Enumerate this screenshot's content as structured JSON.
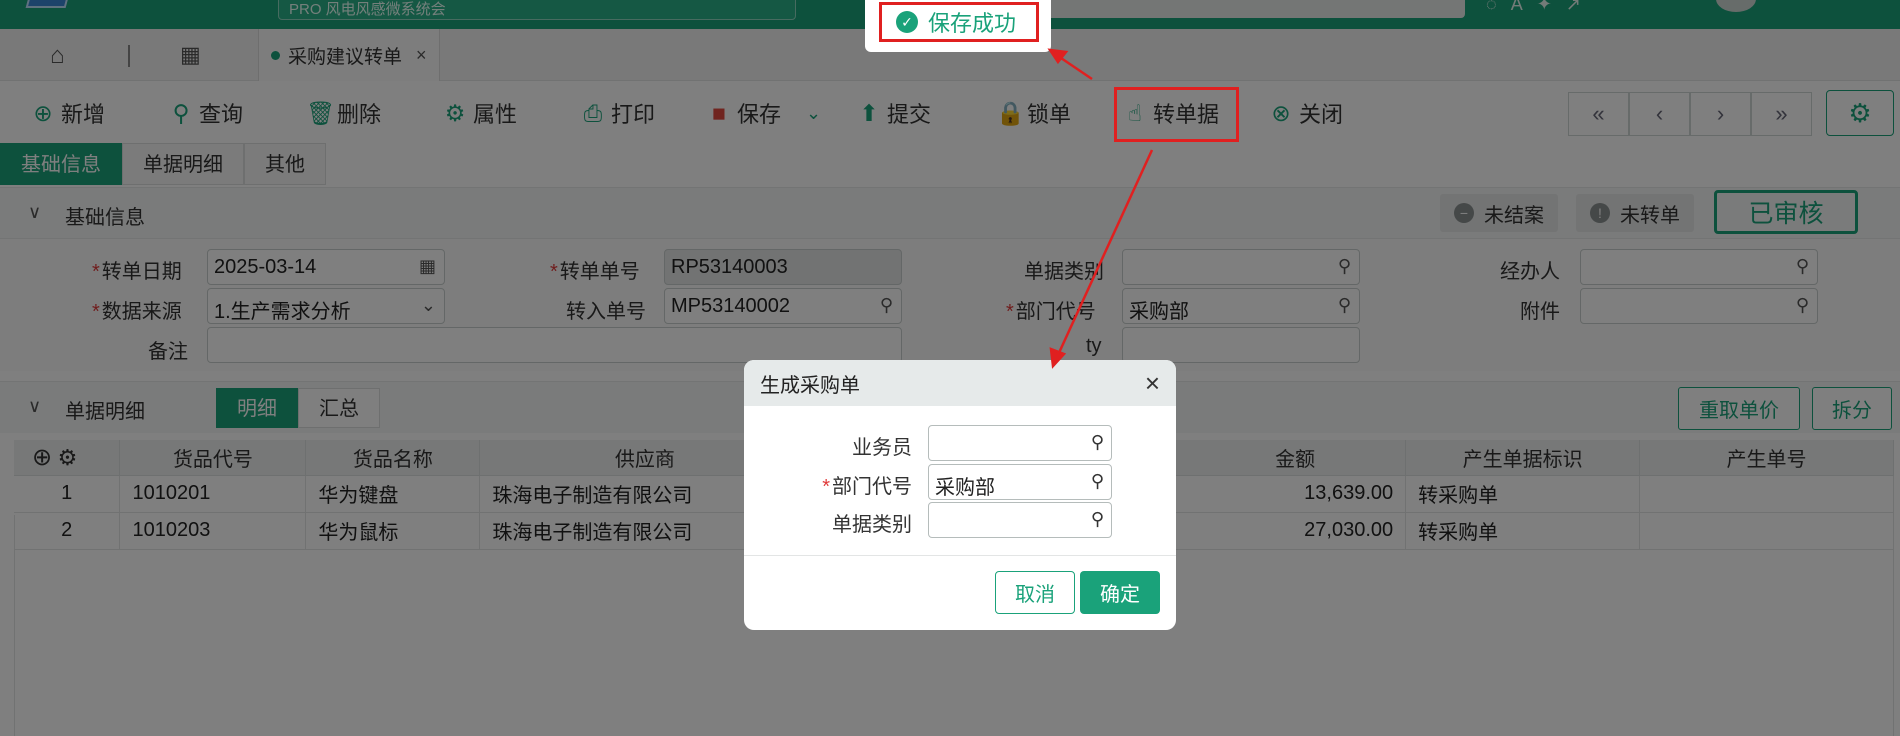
{
  "app": {
    "search_text": "PRO 风电风感微系统会"
  },
  "tabbar": {
    "active_tab": "采购建议转单"
  },
  "toolbar": {
    "add": "新增",
    "query": "查询",
    "delete": "删除",
    "props": "属性",
    "print": "打印",
    "save": "保存",
    "submit": "提交",
    "lock": "锁单",
    "convert": "转单据",
    "close": "关闭"
  },
  "subtabs": [
    "基础信息",
    "单据明细",
    "其他"
  ],
  "basic": {
    "section_title": "基础信息",
    "status_unclosed": "未结案",
    "status_unconverted": "未转单",
    "status_approved": "已审核",
    "fields": {
      "convert_date_label": "转单日期",
      "convert_date": "2025-03-14",
      "convert_no_label": "转单单号",
      "convert_no": "RP53140003",
      "doc_type_label": "单据类别",
      "doc_type": "",
      "handler_label": "经办人",
      "handler": "",
      "source_label": "数据来源",
      "source": "1.生产需求分析",
      "import_no_label": "转入单号",
      "import_no": "MP53140002",
      "dept_label": "部门代号",
      "dept": "采购部",
      "attach_label": "附件",
      "attach": "",
      "remark_label": "备注",
      "remark": "",
      "ty_label": "ty",
      "ty": ""
    }
  },
  "detail": {
    "section_title": "单据明细",
    "tab_detail": "明细",
    "tab_summary": "汇总",
    "reprice": "重取单价",
    "split": "拆分",
    "columns": [
      "货品代号",
      "货品名称",
      "供应商",
      "金额",
      "产生单据标识",
      "产生单号"
    ],
    "rows": [
      {
        "idx": "1",
        "code": "1010201",
        "name": "华为键盘",
        "supplier": "珠海电子制造有限公司",
        "amount": "13,639.00",
        "flag": "转采购单",
        "gen_no": ""
      },
      {
        "idx": "2",
        "code": "1010203",
        "name": "华为鼠标",
        "supplier": "珠海电子制造有限公司",
        "amount": "27,030.00",
        "flag": "转采购单",
        "gen_no": ""
      }
    ]
  },
  "modal": {
    "title": "生成采购单",
    "salesman_label": "业务员",
    "salesman": "",
    "dept_label": "部门代号",
    "dept": "采购部",
    "doc_type_label": "单据类别",
    "doc_type": "",
    "cancel": "取消",
    "ok": "确定"
  },
  "toast": {
    "message": "保存成功"
  },
  "colors": {
    "accent": "#1aa27a",
    "annotation_red": "#e02020"
  }
}
